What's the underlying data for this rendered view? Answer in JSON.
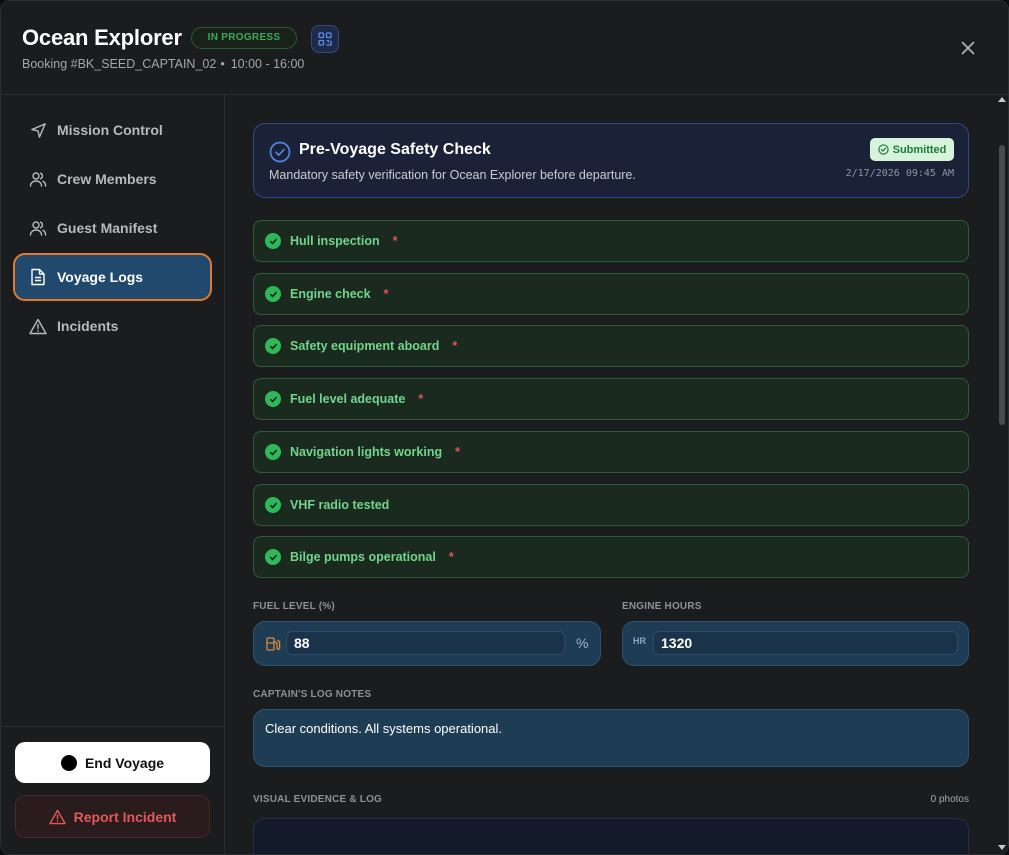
{
  "header": {
    "title": "Ocean Explorer",
    "status": "IN PROGRESS",
    "booking": "Booking #BK_SEED_CAPTAIN_02",
    "time": "10:00 - 16:00"
  },
  "sidebar": {
    "items": [
      {
        "label": "Mission Control",
        "icon": "navigation-arrow-icon"
      },
      {
        "label": "Crew Members",
        "icon": "users-icon"
      },
      {
        "label": "Guest Manifest",
        "icon": "users-icon"
      },
      {
        "label": "Voyage Logs",
        "icon": "document-icon",
        "active": true
      },
      {
        "label": "Incidents",
        "icon": "warning-triangle-icon"
      }
    ],
    "end_voyage": "End Voyage",
    "report_incident": "Report Incident"
  },
  "check": {
    "title": "Pre-Voyage Safety Check",
    "description": "Mandatory safety verification for Ocean Explorer before departure.",
    "status": "Submitted",
    "timestamp": "2/17/2026 09:45 AM",
    "items": [
      {
        "label": "Hull inspection",
        "required": true,
        "checked": true
      },
      {
        "label": "Engine check",
        "required": true,
        "checked": true
      },
      {
        "label": "Safety equipment aboard",
        "required": true,
        "checked": true
      },
      {
        "label": "Fuel level adequate",
        "required": true,
        "checked": true
      },
      {
        "label": "Navigation lights working",
        "required": true,
        "checked": true
      },
      {
        "label": "VHF radio tested",
        "required": false,
        "checked": true
      },
      {
        "label": "Bilge pumps operational",
        "required": true,
        "checked": true
      }
    ],
    "required_marker": "*"
  },
  "fuel": {
    "label": "FUEL LEVEL (%)",
    "value": "88",
    "suffix": "%"
  },
  "engine": {
    "label": "ENGINE HOURS",
    "prefix": "HR",
    "value": "1320"
  },
  "notes": {
    "label": "CAPTAIN'S LOG NOTES",
    "value": "Clear conditions. All systems operational."
  },
  "evidence": {
    "label": "VISUAL EVIDENCE & LOG",
    "count": "0 photos"
  },
  "colors": {
    "accent_active_border": "#e07a2c",
    "active_bg": "#21486d",
    "success": "#2fb85a",
    "danger": "#e0525a"
  }
}
